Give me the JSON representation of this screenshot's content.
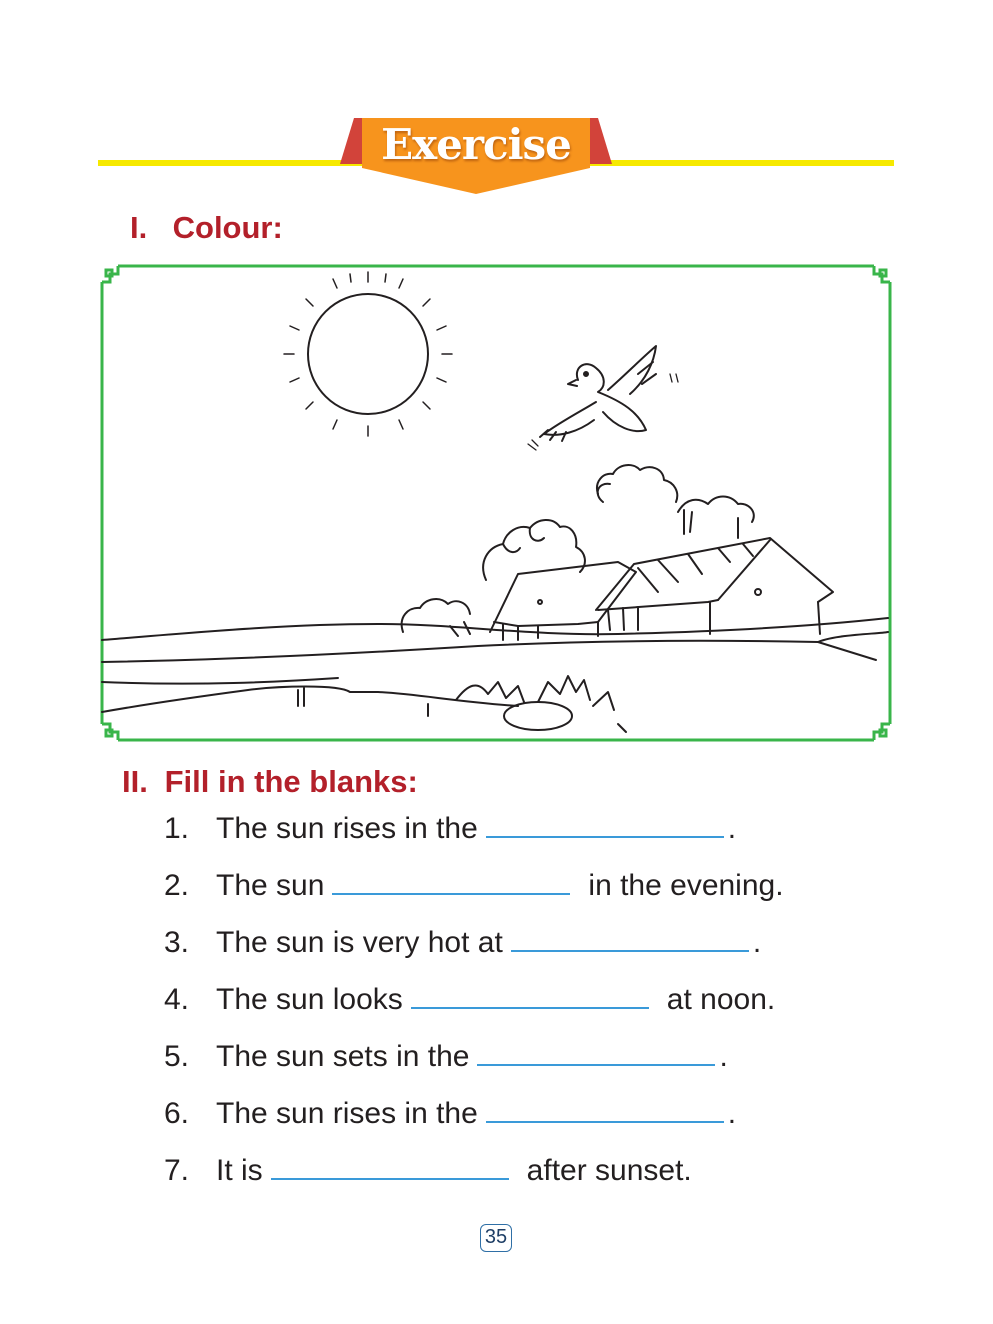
{
  "header": {
    "title": "Exercise"
  },
  "sections": [
    {
      "number": "I.",
      "title": "Colour:"
    },
    {
      "number": "II.",
      "title": "Fill in the blanks:"
    }
  ],
  "picture": {
    "depicts": [
      "sun",
      "bird",
      "trees",
      "huts",
      "hills",
      "pond",
      "grass"
    ]
  },
  "blanks": [
    {
      "num": "1.",
      "before": "The sun rises in the",
      "after": "."
    },
    {
      "num": "2.",
      "before": "The sun",
      "after": "in the evening."
    },
    {
      "num": "3.",
      "before": "The sun is very hot at",
      "after": "."
    },
    {
      "num": "4.",
      "before": "The sun looks",
      "after": "at noon."
    },
    {
      "num": "5.",
      "before": "The sun sets in the",
      "after": "."
    },
    {
      "num": "6.",
      "before": "The sun rises in the",
      "after": "."
    },
    {
      "num": "7.",
      "before": "It is",
      "after": "after sunset."
    }
  ],
  "page": {
    "number": "35"
  },
  "colors": {
    "banner": "#f7941d",
    "banner_side": "#d2433a",
    "header_line": "#f6e900",
    "heading": "#b3202a",
    "frame": "#39b54a",
    "blank_line": "#3a9ad9"
  }
}
